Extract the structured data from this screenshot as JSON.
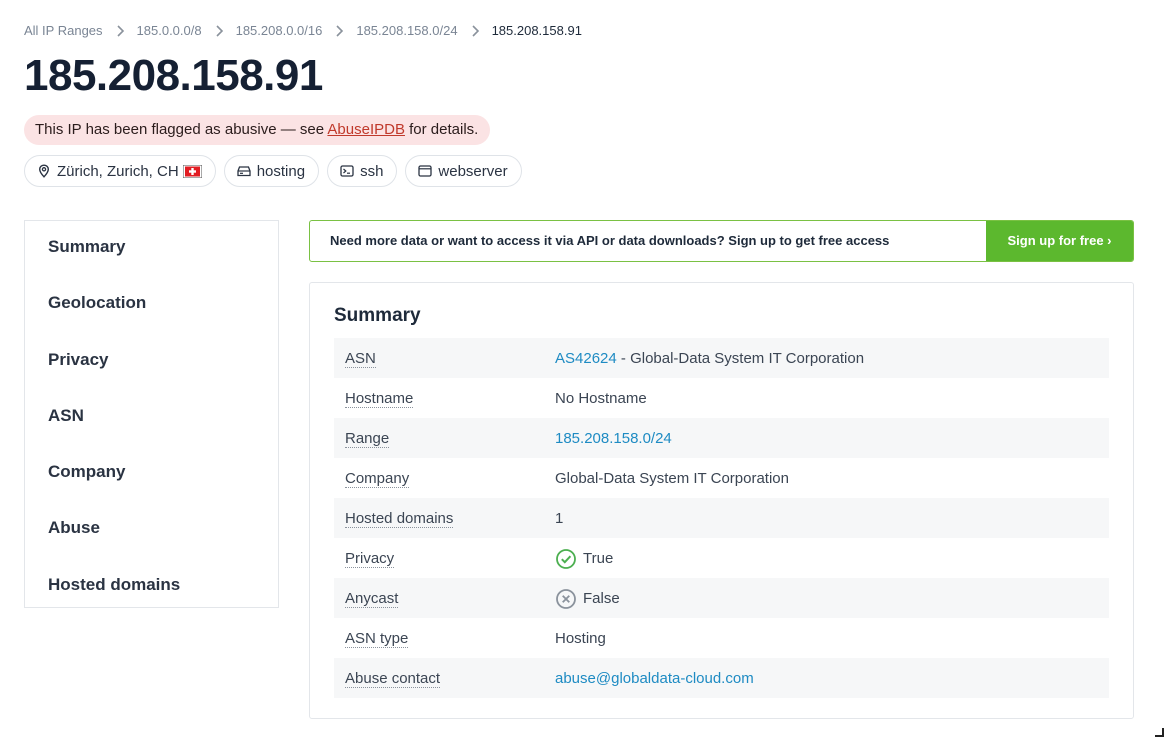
{
  "breadcrumb": [
    {
      "label": "All IP Ranges"
    },
    {
      "label": "185.0.0.0/8"
    },
    {
      "label": "185.208.0.0/16"
    },
    {
      "label": "185.208.158.0/24"
    },
    {
      "label": "185.208.158.91"
    }
  ],
  "title": "185.208.158.91",
  "abuse": {
    "prefix": "This IP has been flagged as abusive — see ",
    "link": "AbuseIPDB",
    "suffix": " for details."
  },
  "tags": {
    "location": "Zürich, Zurich, CH",
    "hosting": "hosting",
    "ssh": "ssh",
    "webserver": "webserver"
  },
  "sidebar": [
    "Summary",
    "Geolocation",
    "Privacy",
    "ASN",
    "Company",
    "Abuse",
    "Hosted domains"
  ],
  "cta": {
    "text": "Need more data or want to access it via API or data downloads? Sign up to get free access",
    "button": "Sign up for free ›"
  },
  "summary": {
    "heading": "Summary",
    "asn": {
      "label": "ASN",
      "link": "AS42624",
      "rest": " - Global-Data System IT Corporation"
    },
    "hostname": {
      "label": "Hostname",
      "value": "No Hostname"
    },
    "range": {
      "label": "Range",
      "value": "185.208.158.0/24"
    },
    "company": {
      "label": "Company",
      "value": "Global-Data System IT Corporation"
    },
    "hosted_domains": {
      "label": "Hosted domains",
      "value": "1"
    },
    "privacy": {
      "label": "Privacy",
      "value": "True"
    },
    "anycast": {
      "label": "Anycast",
      "value": "False"
    },
    "asn_type": {
      "label": "ASN type",
      "value": "Hosting"
    },
    "abuse_contact": {
      "label": "Abuse contact",
      "value": "abuse@globaldata-cloud.com"
    }
  },
  "colors": {
    "accent_green": "#5cb82e",
    "link_blue": "#1e8bc3",
    "abuse_bg": "#fbe3e4",
    "abuse_link": "#c0392b",
    "check_green": "#4caf50"
  }
}
